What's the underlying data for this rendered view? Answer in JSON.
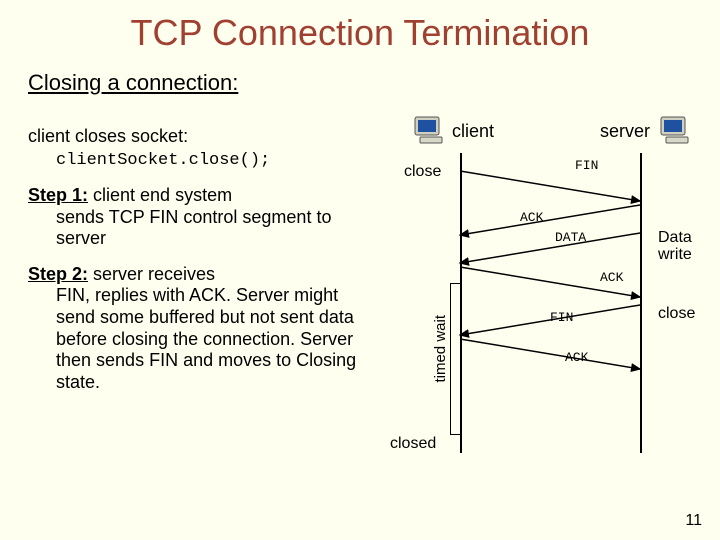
{
  "title": "TCP Connection Termination",
  "subtitle": "Closing a connection:",
  "intro_line1": "client closes socket:",
  "intro_code": "clientSocket.close();",
  "step1_head": "Step 1:",
  "step1_tail": " client end system",
  "step1_body": "sends TCP FIN control segment to server",
  "step2_head": "Step 2:",
  "step2_tail": " server receives",
  "step2_body": "FIN, replies with ACK. Server might send some buffered but not sent data before closing the connection. Server then sends FIN and moves to Closing state.",
  "diagram": {
    "host_client": "client",
    "host_server": "server",
    "evt_close": "close",
    "evt_closed": "closed",
    "evt_datawrite": "Data write",
    "evt_close2": "close",
    "msg_fin1": "FIN",
    "msg_ack1": "ACK",
    "msg_data": "DATA",
    "msg_ack2": "ACK",
    "msg_fin2": "FIN",
    "msg_ack3": "ACK",
    "timed_wait": "timed wait"
  },
  "pagenum": "11"
}
